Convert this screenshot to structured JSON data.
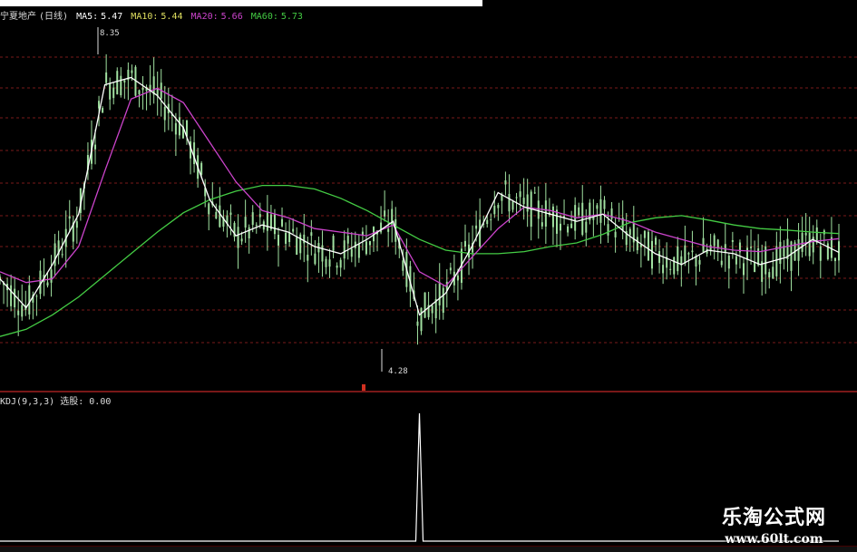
{
  "header": {
    "stock_name": "宁夏地产",
    "period": "(日线)",
    "ma5": {
      "label": "MA5:",
      "value": "5.47",
      "color": "#ffffff"
    },
    "ma10": {
      "label": "MA10:",
      "value": "5.44",
      "color": "#e0e060"
    },
    "ma20": {
      "label": "MA20:",
      "value": "5.66",
      "color": "#cc44cc"
    },
    "ma60": {
      "label": "MA60:",
      "value": "5.73",
      "color": "#44cc44"
    }
  },
  "annotations": {
    "high": "8.35",
    "low": "4.28"
  },
  "kdj": {
    "label": "KDJ(9,3,3) 选股:",
    "value": "0.00"
  },
  "watermark": {
    "line1": "乐淘公式网",
    "line2": "www.60lt.com"
  },
  "colors": {
    "background": "#000000",
    "grid": "#7a1a1a",
    "candle": "#a0e0a0",
    "ma5": "#ffffff",
    "ma10": "#e0e060",
    "ma20": "#cc44cc",
    "ma60": "#44cc44",
    "signal": "#ffffff"
  },
  "chart_data": {
    "type": "line",
    "title": "宁夏地产 (日线)",
    "series": [
      {
        "name": "MA60",
        "values": [
          4.3,
          4.4,
          4.6,
          4.85,
          5.15,
          5.45,
          5.75,
          6.02,
          6.2,
          6.32,
          6.4,
          6.4,
          6.35,
          6.22,
          6.05,
          5.85,
          5.65,
          5.5,
          5.45,
          5.45,
          5.48,
          5.55,
          5.6,
          5.72,
          5.88,
          5.95,
          5.98,
          5.92,
          5.85,
          5.8,
          5.78,
          5.75,
          5.73
        ]
      },
      {
        "name": "MA20",
        "values": [
          5.2,
          5.05,
          5.1,
          5.55,
          6.6,
          7.6,
          7.75,
          7.55,
          7.0,
          6.45,
          6.05,
          5.95,
          5.8,
          5.75,
          5.7,
          5.85,
          5.2,
          5.0,
          5.4,
          5.8,
          6.1,
          6.05,
          5.95,
          6.0,
          5.9,
          5.75,
          5.65,
          5.55,
          5.5,
          5.48,
          5.55,
          5.62,
          5.66
        ]
      },
      {
        "name": "MA5",
        "values": [
          5.1,
          4.7,
          5.3,
          6.0,
          7.8,
          7.9,
          7.65,
          7.2,
          6.2,
          5.7,
          5.85,
          5.75,
          5.55,
          5.45,
          5.65,
          5.9,
          4.6,
          4.9,
          5.55,
          6.3,
          6.1,
          6.0,
          5.9,
          6.0,
          5.7,
          5.45,
          5.3,
          5.5,
          5.45,
          5.3,
          5.4,
          5.65,
          5.47
        ]
      }
    ],
    "kdj_signal": [
      0,
      0,
      0,
      0,
      0,
      0,
      0,
      0,
      0,
      0,
      0,
      0,
      0,
      0,
      0,
      0,
      1,
      0,
      0,
      0,
      0,
      0,
      0,
      0,
      0,
      0,
      0,
      0,
      0,
      0,
      0,
      0,
      0
    ],
    "ylim": [
      4.0,
      8.6
    ]
  }
}
